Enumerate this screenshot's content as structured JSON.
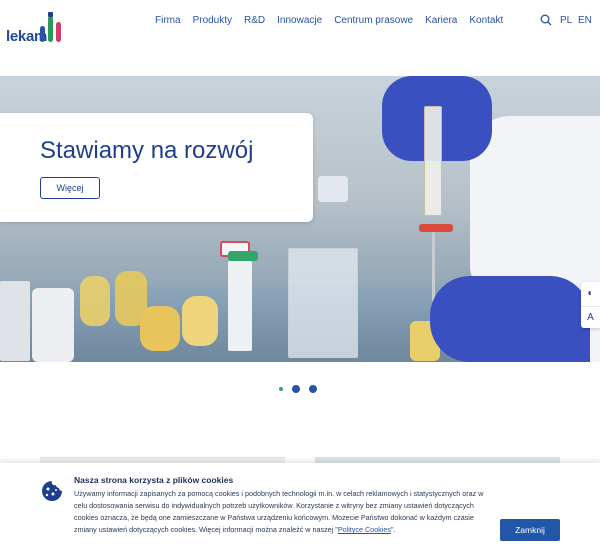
{
  "header": {
    "logo_text": "lekam",
    "nav": [
      "Firma",
      "Produkty",
      "R&D",
      "Innowacje",
      "Centrum prasowe",
      "Kariera",
      "Kontakt"
    ],
    "lang_pl": "PL",
    "lang_en": "EN",
    "search_icon": "search-icon"
  },
  "hero": {
    "title": "Stawiamy na rozwój",
    "button_label": "Więcej",
    "image_label": "laboratory-syringe-photo"
  },
  "side_tools": {
    "contrast_icon": "◐",
    "font_icon": "A"
  },
  "slider": {
    "dots": 3,
    "active": 0
  },
  "cookie": {
    "title": "Nasza strona korzysta z plików cookies",
    "text": "Używamy informacji zapisanych za pomocą cookies i podobnych technologii m.in. w celach reklamowych i statystycznych oraz w celu dostosowania serwisu do indywidualnych potrzeb użytkowników. Korzystanie z witryny bez zmiany ustawień dotyczących cookies oznacza, że będą one zamieszczane w Państwa urządzeniu końcowym. Możecie Państwo dokonać w każdym czasie zmiany ustawień dotyczących cookies. Więcej informacji można znaleźć w naszej \"",
    "link_text": "Polityce Cookies",
    "text_end": "\".",
    "button_label": "Zamknij"
  },
  "colors": {
    "brand_blue": "#1e3f8f",
    "button_blue": "#2256a8"
  }
}
